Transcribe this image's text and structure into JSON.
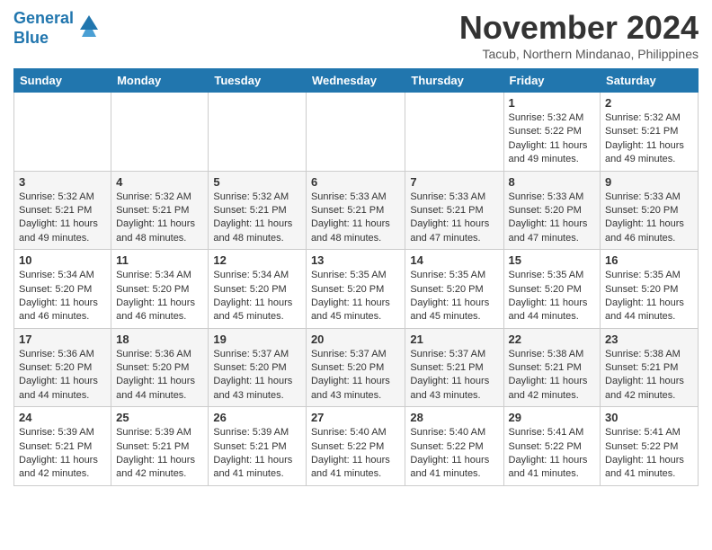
{
  "header": {
    "logo_line1": "General",
    "logo_line2": "Blue",
    "month_title": "November 2024",
    "subtitle": "Tacub, Northern Mindanao, Philippines"
  },
  "weekdays": [
    "Sunday",
    "Monday",
    "Tuesday",
    "Wednesday",
    "Thursday",
    "Friday",
    "Saturday"
  ],
  "weeks": [
    [
      {
        "day": "",
        "info": ""
      },
      {
        "day": "",
        "info": ""
      },
      {
        "day": "",
        "info": ""
      },
      {
        "day": "",
        "info": ""
      },
      {
        "day": "",
        "info": ""
      },
      {
        "day": "1",
        "info": "Sunrise: 5:32 AM\nSunset: 5:22 PM\nDaylight: 11 hours and 49 minutes."
      },
      {
        "day": "2",
        "info": "Sunrise: 5:32 AM\nSunset: 5:21 PM\nDaylight: 11 hours and 49 minutes."
      }
    ],
    [
      {
        "day": "3",
        "info": "Sunrise: 5:32 AM\nSunset: 5:21 PM\nDaylight: 11 hours and 49 minutes."
      },
      {
        "day": "4",
        "info": "Sunrise: 5:32 AM\nSunset: 5:21 PM\nDaylight: 11 hours and 48 minutes."
      },
      {
        "day": "5",
        "info": "Sunrise: 5:32 AM\nSunset: 5:21 PM\nDaylight: 11 hours and 48 minutes."
      },
      {
        "day": "6",
        "info": "Sunrise: 5:33 AM\nSunset: 5:21 PM\nDaylight: 11 hours and 48 minutes."
      },
      {
        "day": "7",
        "info": "Sunrise: 5:33 AM\nSunset: 5:21 PM\nDaylight: 11 hours and 47 minutes."
      },
      {
        "day": "8",
        "info": "Sunrise: 5:33 AM\nSunset: 5:20 PM\nDaylight: 11 hours and 47 minutes."
      },
      {
        "day": "9",
        "info": "Sunrise: 5:33 AM\nSunset: 5:20 PM\nDaylight: 11 hours and 46 minutes."
      }
    ],
    [
      {
        "day": "10",
        "info": "Sunrise: 5:34 AM\nSunset: 5:20 PM\nDaylight: 11 hours and 46 minutes."
      },
      {
        "day": "11",
        "info": "Sunrise: 5:34 AM\nSunset: 5:20 PM\nDaylight: 11 hours and 46 minutes."
      },
      {
        "day": "12",
        "info": "Sunrise: 5:34 AM\nSunset: 5:20 PM\nDaylight: 11 hours and 45 minutes."
      },
      {
        "day": "13",
        "info": "Sunrise: 5:35 AM\nSunset: 5:20 PM\nDaylight: 11 hours and 45 minutes."
      },
      {
        "day": "14",
        "info": "Sunrise: 5:35 AM\nSunset: 5:20 PM\nDaylight: 11 hours and 45 minutes."
      },
      {
        "day": "15",
        "info": "Sunrise: 5:35 AM\nSunset: 5:20 PM\nDaylight: 11 hours and 44 minutes."
      },
      {
        "day": "16",
        "info": "Sunrise: 5:35 AM\nSunset: 5:20 PM\nDaylight: 11 hours and 44 minutes."
      }
    ],
    [
      {
        "day": "17",
        "info": "Sunrise: 5:36 AM\nSunset: 5:20 PM\nDaylight: 11 hours and 44 minutes."
      },
      {
        "day": "18",
        "info": "Sunrise: 5:36 AM\nSunset: 5:20 PM\nDaylight: 11 hours and 44 minutes."
      },
      {
        "day": "19",
        "info": "Sunrise: 5:37 AM\nSunset: 5:20 PM\nDaylight: 11 hours and 43 minutes."
      },
      {
        "day": "20",
        "info": "Sunrise: 5:37 AM\nSunset: 5:20 PM\nDaylight: 11 hours and 43 minutes."
      },
      {
        "day": "21",
        "info": "Sunrise: 5:37 AM\nSunset: 5:21 PM\nDaylight: 11 hours and 43 minutes."
      },
      {
        "day": "22",
        "info": "Sunrise: 5:38 AM\nSunset: 5:21 PM\nDaylight: 11 hours and 42 minutes."
      },
      {
        "day": "23",
        "info": "Sunrise: 5:38 AM\nSunset: 5:21 PM\nDaylight: 11 hours and 42 minutes."
      }
    ],
    [
      {
        "day": "24",
        "info": "Sunrise: 5:39 AM\nSunset: 5:21 PM\nDaylight: 11 hours and 42 minutes."
      },
      {
        "day": "25",
        "info": "Sunrise: 5:39 AM\nSunset: 5:21 PM\nDaylight: 11 hours and 42 minutes."
      },
      {
        "day": "26",
        "info": "Sunrise: 5:39 AM\nSunset: 5:21 PM\nDaylight: 11 hours and 41 minutes."
      },
      {
        "day": "27",
        "info": "Sunrise: 5:40 AM\nSunset: 5:22 PM\nDaylight: 11 hours and 41 minutes."
      },
      {
        "day": "28",
        "info": "Sunrise: 5:40 AM\nSunset: 5:22 PM\nDaylight: 11 hours and 41 minutes."
      },
      {
        "day": "29",
        "info": "Sunrise: 5:41 AM\nSunset: 5:22 PM\nDaylight: 11 hours and 41 minutes."
      },
      {
        "day": "30",
        "info": "Sunrise: 5:41 AM\nSunset: 5:22 PM\nDaylight: 11 hours and 41 minutes."
      }
    ]
  ]
}
